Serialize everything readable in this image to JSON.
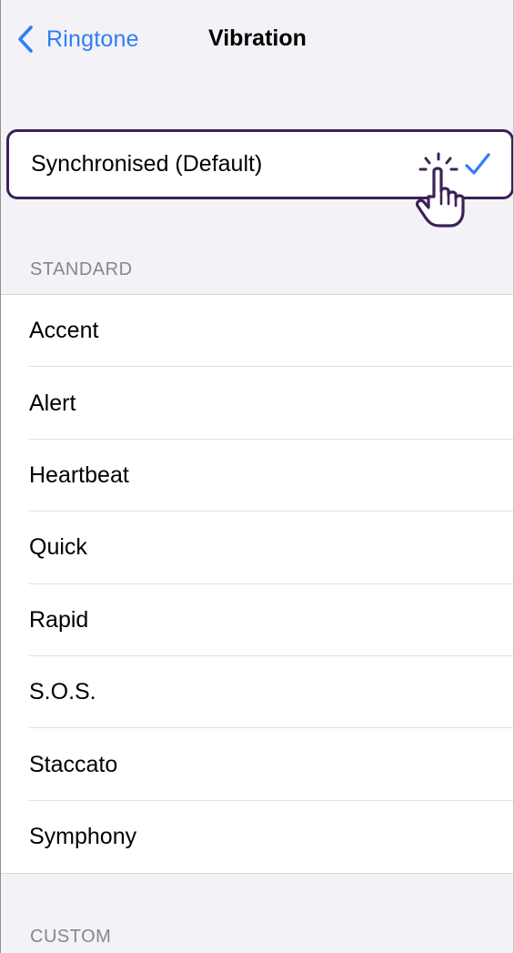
{
  "navbar": {
    "back_label": "Ringtone",
    "title": "Vibration"
  },
  "selected": {
    "label": "Synchronised (Default)",
    "checked": true
  },
  "standard": {
    "header": "STANDARD",
    "items": [
      {
        "label": "Accent"
      },
      {
        "label": "Alert"
      },
      {
        "label": "Heartbeat"
      },
      {
        "label": "Quick"
      },
      {
        "label": "Rapid"
      },
      {
        "label": "S.O.S."
      },
      {
        "label": "Staccato"
      },
      {
        "label": "Symphony"
      }
    ]
  },
  "custom": {
    "header": "CUSTOM"
  },
  "colors": {
    "accent": "#2f7ef6",
    "highlight_border": "#3b2158",
    "background": "#f2f2f7"
  },
  "icons": {
    "back": "chevron-left-icon",
    "check": "checkmark-icon",
    "tap": "hand-pointer-tap-icon"
  }
}
